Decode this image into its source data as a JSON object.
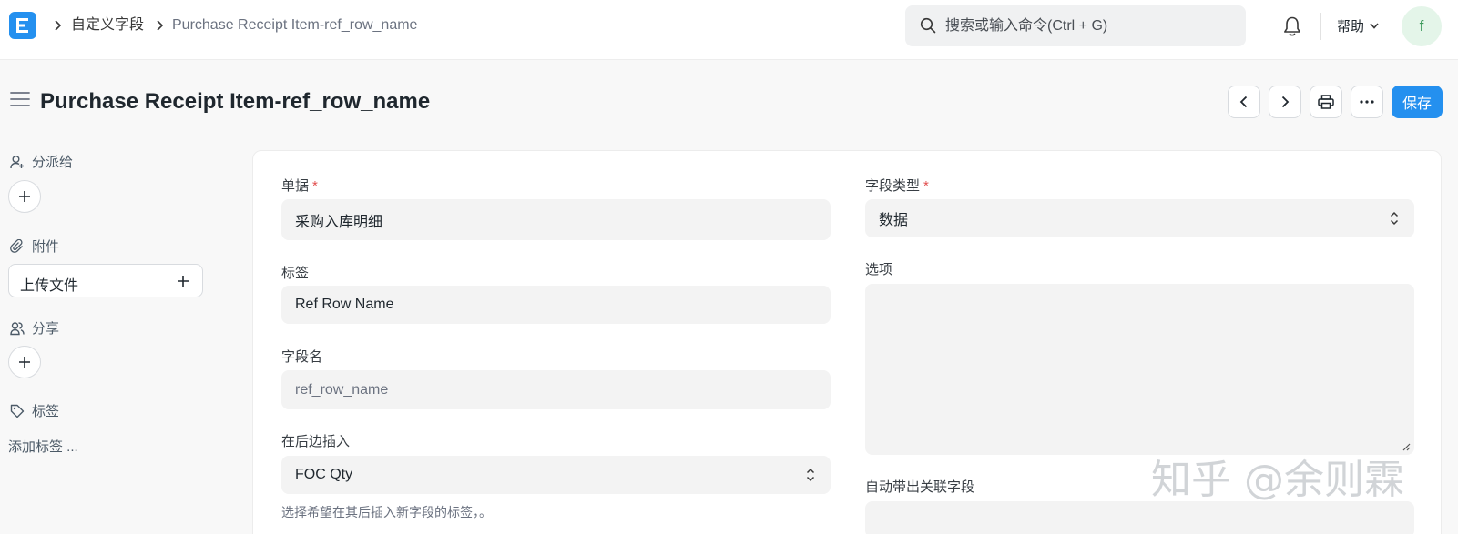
{
  "navbar": {
    "logo_letter": "E",
    "breadcrumbs": [
      "自定义字段",
      "Purchase Receipt Item-ref_row_name"
    ],
    "search_placeholder": "搜索或输入命令(Ctrl + G)",
    "help_label": "帮助",
    "avatar_initial": "f"
  },
  "page": {
    "title": "Purchase Receipt Item-ref_row_name",
    "save_label": "保存"
  },
  "sidebar": {
    "assign_label": "分派给",
    "attachments_label": "附件",
    "upload_label": "上传文件",
    "share_label": "分享",
    "tags_label": "标签",
    "add_tag_label": "添加标签 ..."
  },
  "form": {
    "doctype": {
      "label": "单据",
      "value": "采购入库明细"
    },
    "label": {
      "label": "标签",
      "value": "Ref Row Name"
    },
    "fieldname": {
      "label": "字段名",
      "value": "ref_row_name"
    },
    "insert_after": {
      "label": "在后边插入",
      "value": "FOC Qty",
      "help": "选择希望在其后插入新字段的标签，。"
    },
    "fieldtype": {
      "label": "字段类型",
      "value": "数据"
    },
    "options": {
      "label": "选项",
      "value": ""
    },
    "fetch_from": {
      "label": "自动带出关联字段",
      "value": ""
    }
  },
  "watermark": "知乎 @余则霖",
  "colors": {
    "primary": "#2490ef",
    "required": "#e24c4c"
  }
}
